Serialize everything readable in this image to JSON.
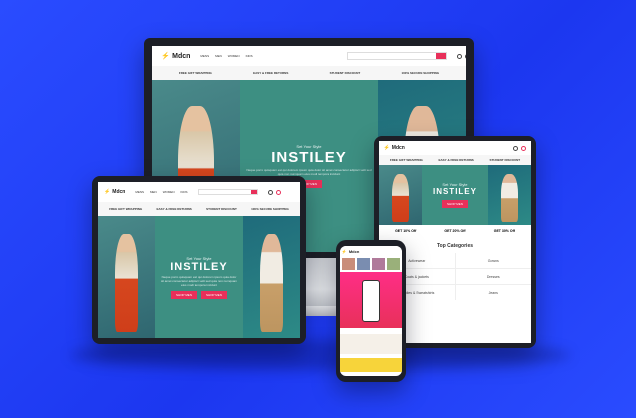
{
  "brand": {
    "logo_text": "Mdcn",
    "accent": "#e8305a",
    "teal": "#3d8f82"
  },
  "menu": [
    "MENS",
    "MEN",
    "WOMEN",
    "KIDS"
  ],
  "search": {
    "placeholder": "Search..."
  },
  "features": [
    "FREE GIFT WRAPPING",
    "EASY & FREE RETURNS",
    "STUDENT DISCOUNT",
    "100% SECURE SHOPPING"
  ],
  "hero": {
    "subtitle": "Set Your Style",
    "title": "INSTILEY",
    "description": "Neque porro quisquam est qui dolorem ipsum quia dolor sit amet consectetur adipisci velit sed quia non numquam eius modi tempora incidunt",
    "cta": "SHOP MEN",
    "cta2": "SHOP MEN"
  },
  "offers": [
    "GET 10% Off",
    "GET 20% Off",
    "GET 30% Off"
  ],
  "categories": {
    "title": "Top Categories",
    "items": [
      "Activewear",
      "Coats & jackets",
      "Hoodies & Sweatshirts",
      "Gowns",
      "Dresses",
      "Jeans"
    ]
  }
}
